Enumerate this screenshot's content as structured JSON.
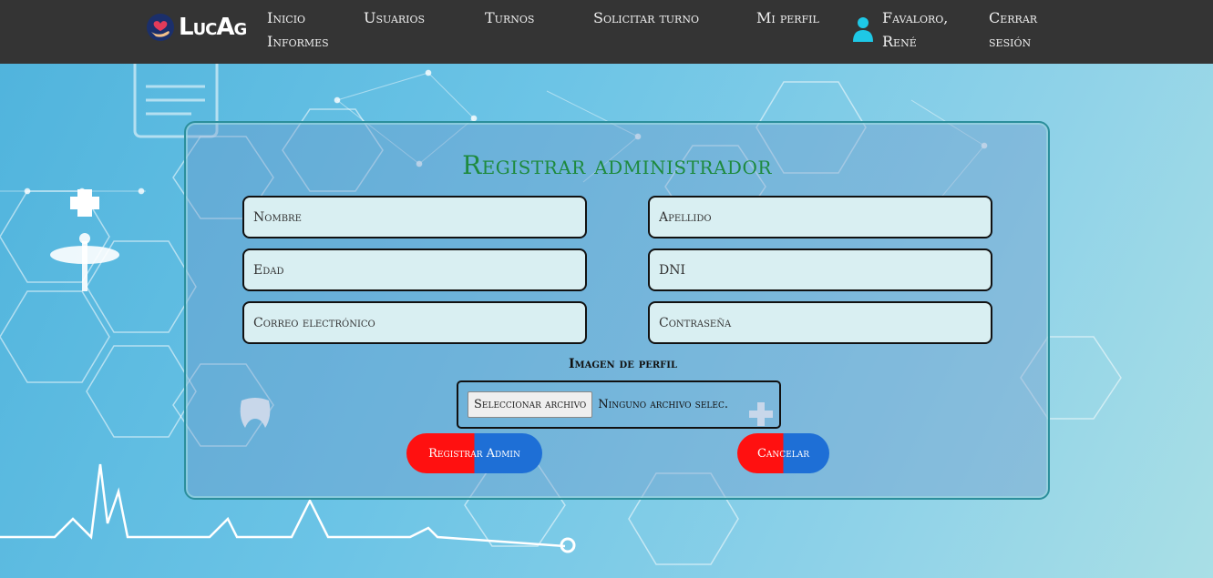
{
  "brand": {
    "name": "LucAg",
    "logo": "heart-hand-logo-icon"
  },
  "nav": {
    "inicio": "Inicio",
    "informes": "Informes",
    "usuarios": "Usuarios",
    "turnos": "Turnos",
    "solicitar": "Solicitar turno",
    "perfil": "Mi perfil",
    "user_icon": "user-icon",
    "user_name": "Favaloro, René",
    "logout": "Cerrar sesión"
  },
  "form": {
    "title": "Registrar administrador",
    "nombre_placeholder": "Nombre",
    "apellido_placeholder": "Apellido",
    "edad_placeholder": "Edad",
    "dni_placeholder": "DNI",
    "correo_placeholder": "Correo electrónico",
    "contrasena_placeholder": "Contraseña",
    "imagen_label": "Imagen de perfil",
    "file_button": "Seleccionar archivo",
    "file_status": "Ninguno archivo selec.",
    "submit_label": "Registrar Admin",
    "cancel_label": "Cancelar"
  },
  "colors": {
    "navbar": "#343434",
    "title": "#1e8a3e",
    "button_red": "#ff1010",
    "button_blue": "#1e6fd6",
    "user_icon": "#1ec8e6"
  }
}
